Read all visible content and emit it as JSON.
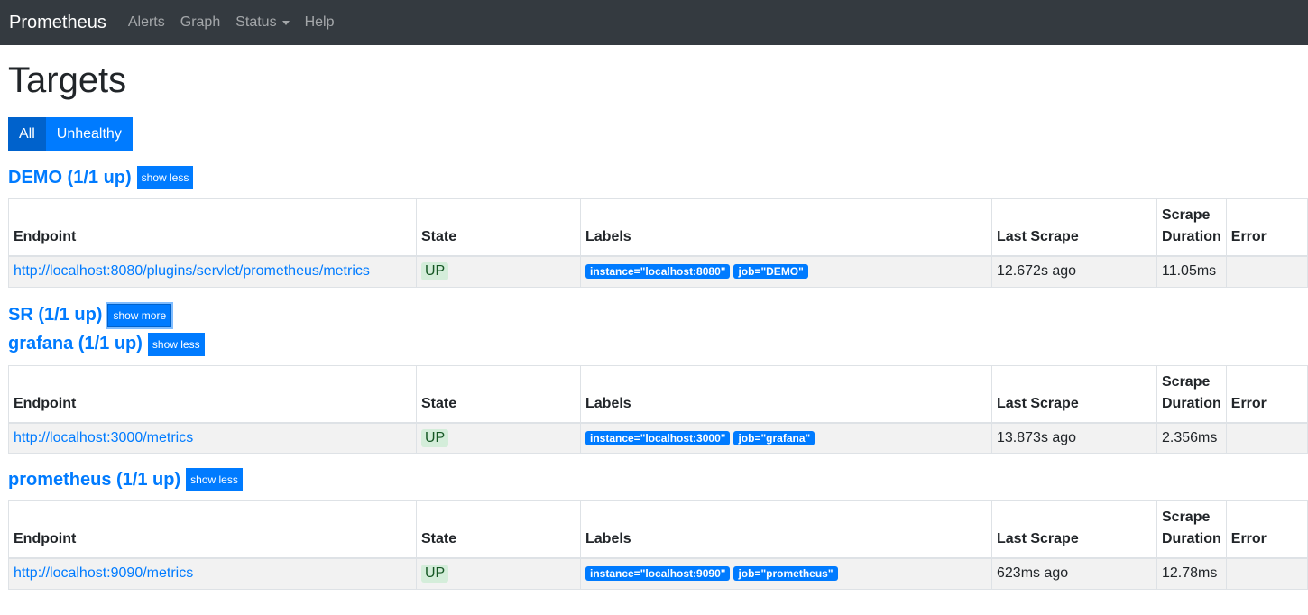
{
  "navbar": {
    "brand": "Prometheus",
    "items": [
      {
        "label": "Alerts"
      },
      {
        "label": "Graph"
      },
      {
        "label": "Status"
      },
      {
        "label": "Help"
      }
    ]
  },
  "page": {
    "title": "Targets",
    "filters": {
      "all": "All",
      "unhealthy": "Unhealthy"
    }
  },
  "columns": {
    "endpoint": "Endpoint",
    "state": "State",
    "labels": "Labels",
    "last_scrape": "Last Scrape",
    "scrape_duration": "Scrape Duration",
    "error": "Error"
  },
  "jobs": [
    {
      "title": "DEMO (1/1 up)",
      "toggle": "show less",
      "row": {
        "endpoint": "http://localhost:8080/plugins/servlet/prometheus/metrics",
        "state": "UP",
        "labels": [
          "instance=\"localhost:8080\"",
          "job=\"DEMO\""
        ],
        "last_scrape": "12.672s ago",
        "duration": "11.05ms",
        "error": ""
      }
    },
    {
      "title": "SR (1/1 up)",
      "toggle": "show more"
    },
    {
      "title": "grafana (1/1 up)",
      "toggle": "show less",
      "row": {
        "endpoint": "http://localhost:3000/metrics",
        "state": "UP",
        "labels": [
          "instance=\"localhost:3000\"",
          "job=\"grafana\""
        ],
        "last_scrape": "13.873s ago",
        "duration": "2.356ms",
        "error": ""
      }
    },
    {
      "title": "prometheus (1/1 up)",
      "toggle": "show less",
      "row": {
        "endpoint": "http://localhost:9090/metrics",
        "state": "UP",
        "labels": [
          "instance=\"localhost:9090\"",
          "job=\"prometheus\""
        ],
        "last_scrape": "623ms ago",
        "duration": "12.78ms",
        "error": ""
      }
    }
  ]
}
